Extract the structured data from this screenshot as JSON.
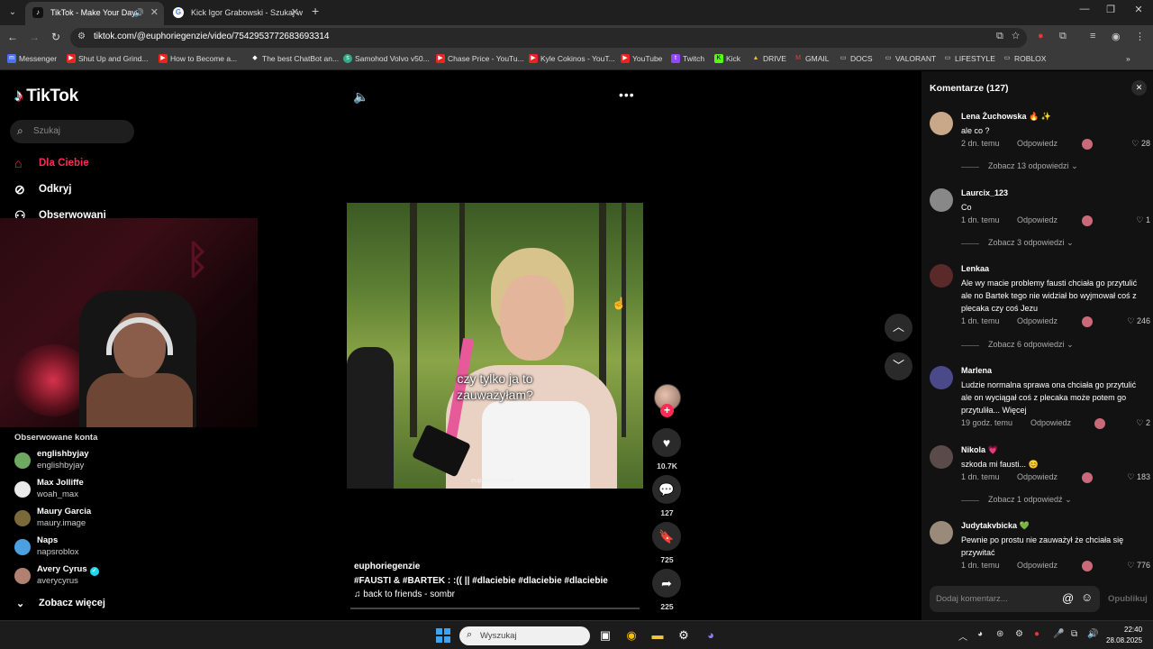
{
  "browser": {
    "tabs": [
      {
        "title": "TikTok - Make Your Day",
        "active": true
      },
      {
        "title": "Kick Igor Grabowski - Szukaj w",
        "active": false
      }
    ],
    "url": "tiktok.com/@euphoriegenzie/video/7542953772683693314",
    "bookmarks": [
      "Messenger",
      "Shut Up and Grind...",
      "How to Become a...",
      "The best ChatBot an...",
      "Samohod Volvo v50...",
      "Chase Price - YouTu...",
      "Kyle Cokinos - YouT...",
      "YouTube",
      "Twitch",
      "Kick",
      "DRIVE",
      "GMAIL",
      "DOCS",
      "VALORANT",
      "LIFESTYLE",
      "ROBLOX"
    ]
  },
  "sidebar": {
    "logo": "TikTok",
    "search_placeholder": "Szukaj",
    "nav": [
      {
        "label": "Dla Ciebie",
        "icon": "home-icon",
        "active": true
      },
      {
        "label": "Odkryj",
        "icon": "compass-icon",
        "active": false
      },
      {
        "label": "Obserwowani",
        "icon": "following-icon",
        "active": false
      }
    ],
    "followed_title": "Obserwowane konta",
    "accounts": [
      {
        "name": "englishbyjay",
        "handle": "englishbyjay",
        "color": "#6fa860"
      },
      {
        "name": "Max Jolliffe",
        "handle": "woah_max",
        "color": "#e9e9e9"
      },
      {
        "name": "Maury Garcia",
        "handle": "maury.image",
        "color": "#7a6a3a"
      },
      {
        "name": "Naps",
        "handle": "napsroblox",
        "color": "#4aa0e0"
      },
      {
        "name": "Avery Cyrus",
        "handle": "averycyrus",
        "color": "#b08070",
        "verified": true
      }
    ],
    "see_more": "Zobacz więcej"
  },
  "video": {
    "caption_line1": "czy tylko ja to",
    "caption_line2": "zauważyłam?",
    "watermark": "euphoriegenzie",
    "username": "euphoriegenzie",
    "description": "#FAUSTI  & #BARTEK : :(( || #dlaciebie  #dlaciebie  #dlaciebie",
    "music": "♫ back to friends - sombr",
    "likes": "10.7K",
    "comments": "127",
    "saves": "725",
    "shares": "225"
  },
  "comments": {
    "title": "Komentarze (127)",
    "reply_label": "Odpowiedz",
    "items": [
      {
        "name": "Lena Żuchowska 🔥 ✨",
        "text": "ale co ?",
        "time": "2 dn. temu",
        "likes": "28",
        "replies": "Zobacz 13 odpowiedzi",
        "color": "#c8a888"
      },
      {
        "name": "Laurcix_123",
        "text": "Co",
        "time": "1 dn. temu",
        "likes": "1",
        "replies": "Zobacz 3 odpowiedzi",
        "color": "#888"
      },
      {
        "name": "Lenkaa",
        "text": "Ale wy macie problemy fausti chciała go przytulić ale no Bartek tego nie widział bo wyjmował coś z plecaka czy coś Jezu",
        "time": "1 dn. temu",
        "likes": "246",
        "replies": "Zobacz 6 odpowiedzi",
        "color": "#5a2a2a"
      },
      {
        "name": "Marlena",
        "text": "Ludzie normalna sprawa ona chciała go przytulić ale on wyciągał coś z plecaka może potem go przytuliła... Więcej",
        "time": "19 godz. temu",
        "likes": "2",
        "replies": "",
        "color": "#4a4a8a"
      },
      {
        "name": "Nikola 💗",
        "text": "szkoda mi fausti... 😊",
        "time": "1 dn. temu",
        "likes": "183",
        "replies": "Zobacz 1 odpowiedź",
        "color": "#5a4a4a"
      },
      {
        "name": "Judytakvbicka 💚",
        "text": "Pewnie po prostu nie zauważył że chciała się przywitać",
        "time": "1 dn. temu",
        "likes": "776",
        "replies": "",
        "color": "#9a8a7a"
      }
    ],
    "input_placeholder": "Dodaj komentarz...",
    "post_label": "Opublikuj"
  },
  "taskbar": {
    "search_placeholder": "Wyszukaj",
    "time": "22:40",
    "date": "28.08.2025"
  }
}
